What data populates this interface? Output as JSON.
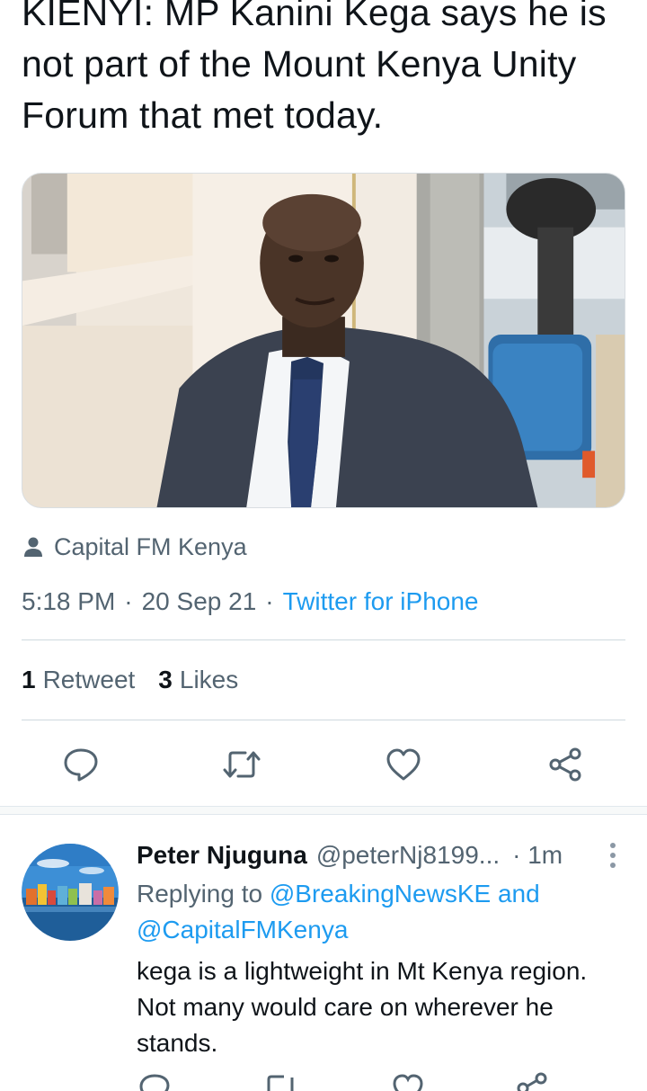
{
  "tweet": {
    "text_lines": [
      "KIENYI: MP Kanini Kega says he is",
      "not part of the Mount Kenya Unity",
      "Forum that met today."
    ],
    "source": "Capital FM Kenya",
    "time": "5:18 PM",
    "date": "20 Sep 21",
    "separator": "·",
    "client": "Twitter for iPhone",
    "retweet_count": "1",
    "retweet_label": "Retweet",
    "like_count": "3",
    "like_label": "Likes",
    "media_alt": "Photo of a man in a suit and tie seated in a blue chair"
  },
  "actions": [
    "reply-icon",
    "retweet-icon",
    "like-icon",
    "share-icon"
  ],
  "reply": {
    "name": "Peter Njuguna",
    "handle": "@peterNj8199...",
    "time": "· 1m",
    "replying_prefix": "Replying to",
    "mention_1": "@BreakingNewsKE",
    "conjunction": "and",
    "mention_2": "@CapitalFMKenya",
    "text": "kega is a lightweight in Mt Kenya region. Not many would care on wherever he stands."
  },
  "colors": {
    "accent": "#1d9bf0",
    "secondary_text": "#536471",
    "primary_text": "#0f1419",
    "divider": "#cfd9de"
  }
}
